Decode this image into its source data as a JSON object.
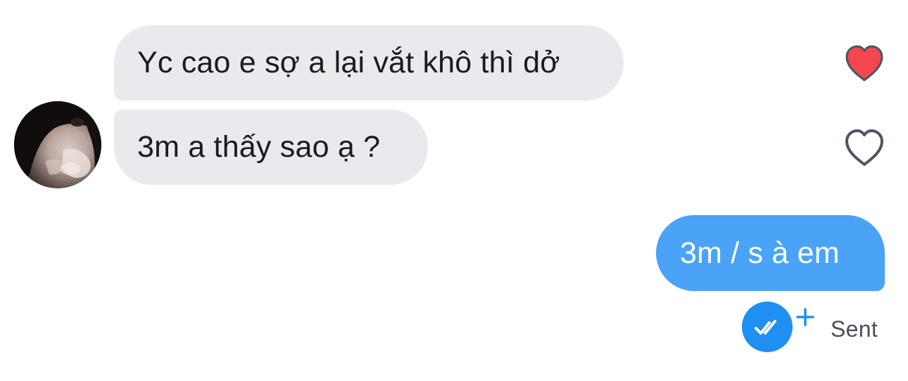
{
  "messages": [
    {
      "direction": "incoming",
      "text": "Yc cao e sợ a lại vắt khô thì dở",
      "liked": true
    },
    {
      "direction": "incoming",
      "text": "3m a thấy sao ạ ?",
      "liked": false
    },
    {
      "direction": "outgoing",
      "text": "3m / s à em"
    }
  ],
  "status": {
    "label": "Sent",
    "icon": "double-check-icon",
    "extra_icon": "plus-icon"
  },
  "colors": {
    "incoming_bubble": "#e9e9ee",
    "outgoing_bubble": "#4aa3f7",
    "like_active": "#f2474f",
    "like_inactive_outline": "#4b5563",
    "status_accent": "#1f8ff2"
  }
}
